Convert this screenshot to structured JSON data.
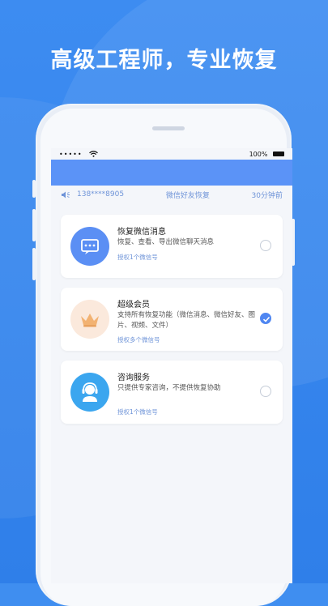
{
  "headline": "高级工程师，专业恢复",
  "status": {
    "signal": "•••••",
    "battery_text": "100%"
  },
  "notice": {
    "phone": "138****8905",
    "action": "微信好友恢复",
    "time": "30分钟前"
  },
  "options": [
    {
      "title": "恢复微信消息",
      "desc": "恢复、查看、导出微信聊天消息",
      "auth": "授权1个微信号",
      "checked": false,
      "icon": "chat-icon",
      "icon_bg": "#5b8ff4"
    },
    {
      "title": "超级会员",
      "desc": "支持所有恢复功能（微信消息、微信好友、图片、视频、文件）",
      "auth": "授权多个微信号",
      "checked": true,
      "icon": "crown-icon",
      "icon_bg": "#fbe9dc"
    },
    {
      "title": "咨询服务",
      "desc": "只提供专家咨询，不提供恢复协助",
      "auth": "授权1个微信号",
      "checked": false,
      "icon": "headset-agent-icon",
      "icon_bg": "#3ba6ef"
    }
  ],
  "colors": {
    "primary": "#5b93f7",
    "link": "#6f94d8",
    "background": "#3d8cf1"
  }
}
